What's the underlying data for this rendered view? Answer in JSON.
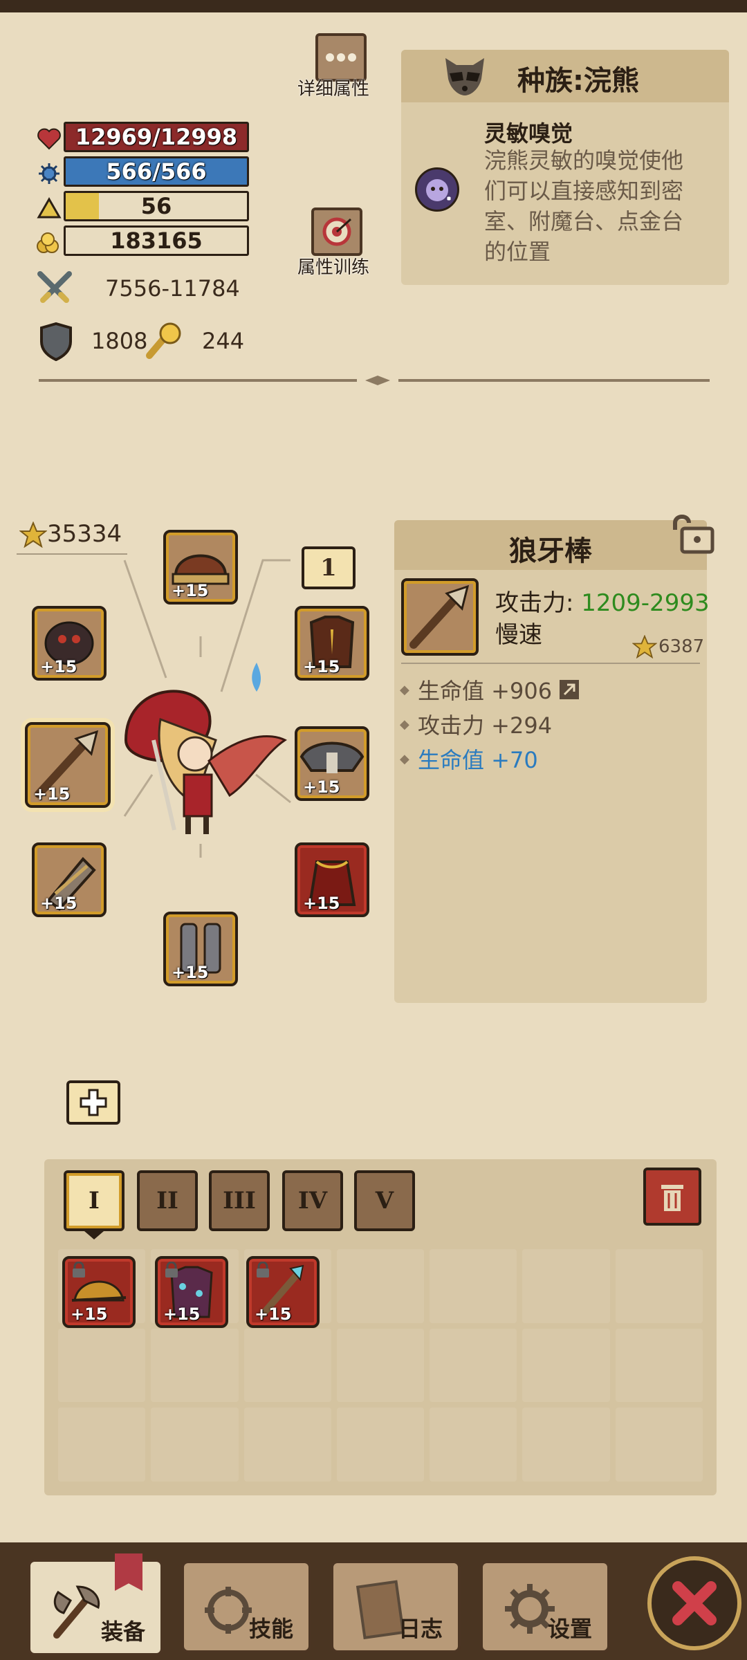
{
  "stats": {
    "hp": "12969/12998",
    "mp": "566/566",
    "level": "56",
    "gold": "183165",
    "attack": "7556-11784",
    "armor": "1808",
    "crit": "244"
  },
  "buttons": {
    "detail_attrs": "详细属性",
    "attr_training": "属性训练"
  },
  "race": {
    "title": "种族:浣熊",
    "trait_name": "灵敏嗅觉",
    "trait_desc": "浣熊灵敏的嗅觉使他们可以直接感知到密室、附魔台、点金台的位置"
  },
  "hero": {
    "power": "35334",
    "page_badge": "1"
  },
  "equipment": {
    "helmet_plus": "+15",
    "amulet_plus": "+15",
    "armor_plus": "+15",
    "weapon_plus": "+15",
    "shoulder_plus": "+15",
    "glove_plus": "+15",
    "cape_plus": "+15",
    "boots_plus": "+15"
  },
  "item": {
    "name": "狼牙棒",
    "attack_label": "攻击力: ",
    "attack_value": "1209-2993",
    "speed": "慢速",
    "score": "6387",
    "stats": [
      {
        "text": "生命值 +906",
        "color": "#5a4a3a"
      },
      {
        "text": "攻击力 +294",
        "color": "#5a4a3a"
      },
      {
        "text": "生命值 +70",
        "color": "#2a7bbf"
      }
    ]
  },
  "inventory": {
    "tabs": [
      "I",
      "II",
      "III",
      "IV",
      "V"
    ],
    "items": [
      {
        "plus": "+15"
      },
      {
        "plus": "+15"
      },
      {
        "plus": "+15"
      }
    ]
  },
  "nav": {
    "equip": "装备",
    "skills": "技能",
    "log": "日志",
    "settings": "设置"
  },
  "colors": {
    "hp": "#8c2a2a",
    "mp": "#3c78b8",
    "xp": "#e3c24a",
    "attack_value": "#2e8b1e",
    "accent_gold": "#d29c2a"
  }
}
